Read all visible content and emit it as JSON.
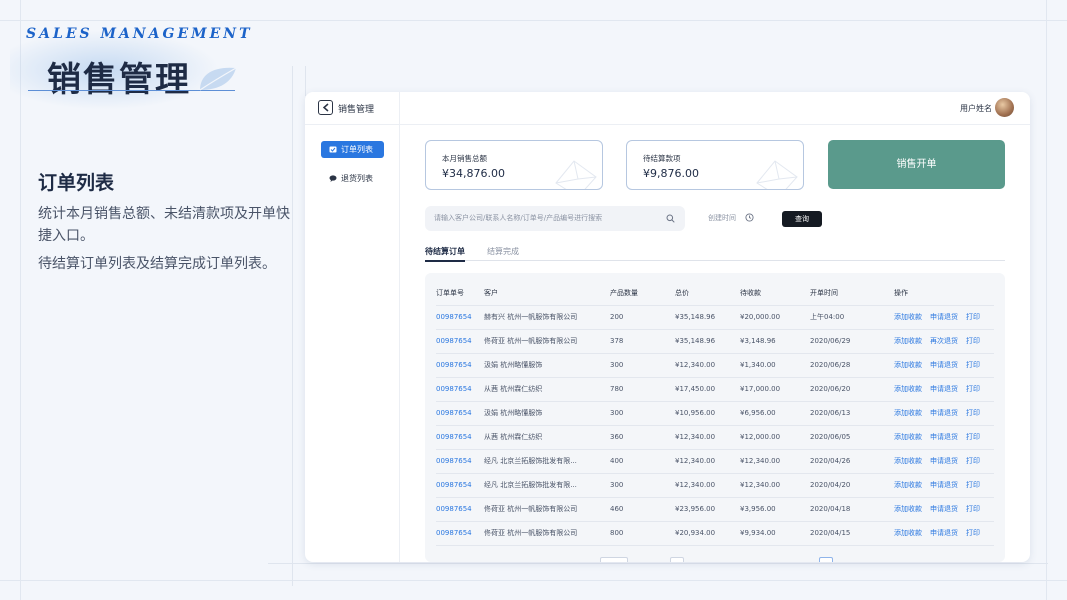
{
  "brand": {
    "en_title": "SALES MANAGEMENT",
    "cn_title": "销售管理"
  },
  "description": {
    "title": "订单列表",
    "para1": "统计本月销售总额、未结清款项及开单快捷入口。",
    "para2": "待结算订单列表及结算完成订单列表。"
  },
  "app": {
    "topbar": {
      "title": "销售管理",
      "user_name": "用户姓名"
    },
    "sidebar": {
      "items": [
        {
          "label": "订单列表",
          "icon": "checkbox-icon",
          "active": true
        },
        {
          "label": "退货列表",
          "icon": "chat-icon",
          "active": false
        }
      ]
    },
    "cards": [
      {
        "label": "本月销售总额",
        "value": "¥34,876.00"
      },
      {
        "label": "待结算款项",
        "value": "¥9,876.00"
      }
    ],
    "open_button": "销售开单",
    "search": {
      "placeholder": "请输入客户公司/联系人名称/订单号/产品编号进行搜索",
      "date_label": "创建时间",
      "query_button": "查询"
    },
    "tabs": [
      "待结算订单",
      "结算完成"
    ],
    "table": {
      "headers": [
        "订单单号",
        "客户",
        "产品数量",
        "总价",
        "待收款",
        "开单时间",
        "操作"
      ],
      "rows": [
        {
          "order": "00987654",
          "customer": "赫有兴  杭州一帆服饰有限公司",
          "qty": "200",
          "total": "¥35,148.96",
          "pending": "¥20,000.00",
          "time": "上午04:00",
          "actions": [
            "添加收款",
            "申请退货",
            "打印"
          ]
        },
        {
          "order": "00987654",
          "customer": "佟荷亚  杭州一帆服饰有限公司",
          "qty": "378",
          "total": "¥35,148.96",
          "pending": "¥3,148.96",
          "time": "2020/06/29",
          "actions": [
            "添加收款",
            "再次退货",
            "打印"
          ]
        },
        {
          "order": "00987654",
          "customer": "汲娟  杭州略懂服饰",
          "qty": "300",
          "total": "¥12,340.00",
          "pending": "¥1,340.00",
          "time": "2020/06/28",
          "actions": [
            "添加收款",
            "申请退货",
            "打印"
          ]
        },
        {
          "order": "00987654",
          "customer": "从茜  杭州霖仁纺织",
          "qty": "780",
          "total": "¥17,450.00",
          "pending": "¥17,000.00",
          "time": "2020/06/20",
          "actions": [
            "添加收款",
            "申请退货",
            "打印"
          ]
        },
        {
          "order": "00987654",
          "customer": "汲娟  杭州略懂服饰",
          "qty": "300",
          "total": "¥10,956.00",
          "pending": "¥6,956.00",
          "time": "2020/06/13",
          "actions": [
            "添加收款",
            "申请退货",
            "打印"
          ]
        },
        {
          "order": "00987654",
          "customer": "从茜  杭州霖仁纺织",
          "qty": "360",
          "total": "¥12,340.00",
          "pending": "¥12,000.00",
          "time": "2020/06/05",
          "actions": [
            "添加收款",
            "申请退货",
            "打印"
          ]
        },
        {
          "order": "00987654",
          "customer": "经凡  北京兰拓服饰批发有限...",
          "qty": "400",
          "total": "¥12,340.00",
          "pending": "¥12,340.00",
          "time": "2020/04/26",
          "actions": [
            "添加收款",
            "申请退货",
            "打印"
          ]
        },
        {
          "order": "00987654",
          "customer": "经凡  北京兰拓服饰批发有限...",
          "qty": "300",
          "total": "¥12,340.00",
          "pending": "¥12,340.00",
          "time": "2020/04/20",
          "actions": [
            "添加收款",
            "申请退货",
            "打印"
          ]
        },
        {
          "order": "00987654",
          "customer": "佟荷亚  杭州一帆服饰有限公司",
          "qty": "460",
          "total": "¥23,956.00",
          "pending": "¥3,956.00",
          "time": "2020/04/18",
          "actions": [
            "添加收款",
            "申请退货",
            "打印"
          ]
        },
        {
          "order": "00987654",
          "customer": "佟荷亚  杭州一帆服饰有限公司",
          "qty": "800",
          "total": "¥20,934.00",
          "pending": "¥9,934.00",
          "time": "2020/04/15",
          "actions": [
            "添加收款",
            "申请退货",
            "打印"
          ]
        }
      ]
    }
  },
  "colors": {
    "accent": "#2a77e0",
    "brand_en": "#1c63c9",
    "open_button": "#5a9a8c",
    "query_button": "#151a22"
  }
}
